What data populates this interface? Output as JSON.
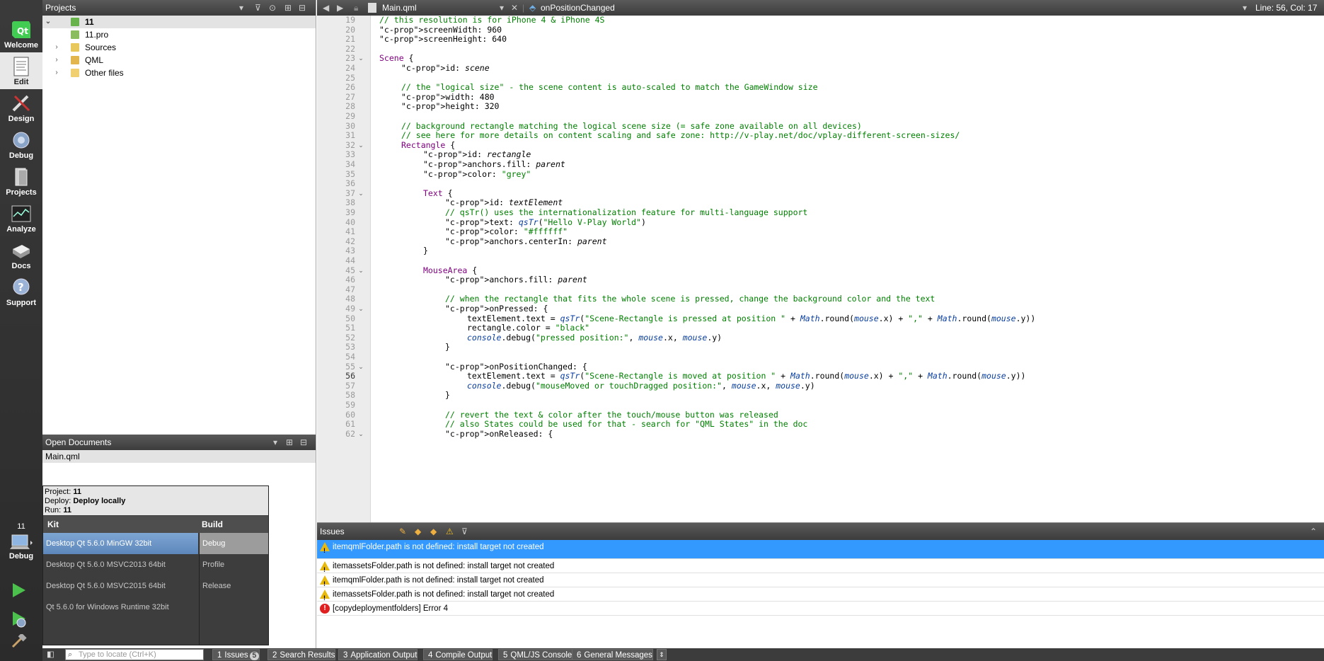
{
  "modes": [
    {
      "label": "Welcome",
      "icon": "qt-logo-icon"
    },
    {
      "label": "Edit",
      "icon": "edit-document-icon"
    },
    {
      "label": "Design",
      "icon": "design-pencil-icon"
    },
    {
      "label": "Debug",
      "icon": "debug-bug-icon"
    },
    {
      "label": "Projects",
      "icon": "projects-book-icon"
    },
    {
      "label": "Analyze",
      "icon": "analyze-chart-icon"
    },
    {
      "label": "Docs",
      "icon": "docs-book-icon"
    },
    {
      "label": "Support",
      "icon": "support-question-icon"
    }
  ],
  "target": {
    "project": "11",
    "mode": "Debug"
  },
  "projects_pane": {
    "title": "Projects",
    "tree": [
      {
        "label": "11"
      },
      {
        "label": "11.pro"
      },
      {
        "label": "Sources"
      },
      {
        "label": "QML"
      },
      {
        "label": "Other files"
      }
    ]
  },
  "open_documents": {
    "title": "Open Documents",
    "items": [
      "Main.qml"
    ]
  },
  "kit_popup": {
    "project_label": "Project:",
    "project": "11",
    "deploy_label": "Deploy:",
    "deploy": "Deploy locally",
    "run_label": "Run:",
    "run": "11",
    "kit_header": "Kit",
    "build_header": "Build",
    "kits": [
      "Desktop Qt 5.6.0 MinGW 32bit",
      "Desktop Qt 5.6.0 MSVC2013 64bit",
      "Desktop Qt 5.6.0 MSVC2015 64bit",
      "Qt 5.6.0 for Windows Runtime 32bit"
    ],
    "builds": [
      "Debug",
      "Profile",
      "Release"
    ]
  },
  "editor": {
    "file": "Main.qml",
    "symbol": "onPositionChanged",
    "position": "Line: 56, Col: 17",
    "first_line": 19
  },
  "issues_pane": {
    "title": "Issues",
    "items": [
      {
        "type": "warning",
        "text": "itemqmlFolder.path is not defined: install target not created"
      },
      {
        "type": "warning",
        "text": "itemassetsFolder.path is not defined: install target not created"
      },
      {
        "type": "warning",
        "text": "itemqmlFolder.path is not defined: install target not created"
      },
      {
        "type": "warning",
        "text": "itemassetsFolder.path is not defined: install target not created"
      },
      {
        "type": "error",
        "text": "[copydeploymentfolders] Error 4"
      }
    ]
  },
  "statusbar": {
    "locator_placeholder": "Type to locate (Ctrl+K)",
    "tabs": [
      {
        "num": "1",
        "label": "Issues",
        "badge": "5"
      },
      {
        "num": "2",
        "label": "Search Results"
      },
      {
        "num": "3",
        "label": "Application Output"
      },
      {
        "num": "4",
        "label": "Compile Output"
      },
      {
        "num": "5",
        "label": "QML/JS Console"
      },
      {
        "num": "6",
        "label": "General Messages"
      }
    ]
  },
  "colors": {
    "mode_bar": "#2b2b2b",
    "selection": "#3399ff",
    "comment": "#008000",
    "keyword": "#800080"
  }
}
